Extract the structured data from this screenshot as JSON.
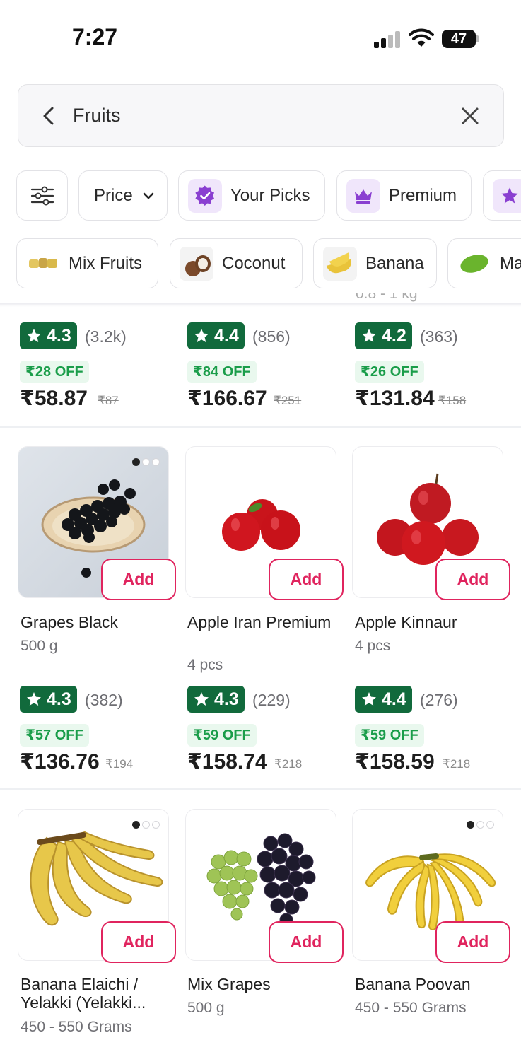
{
  "status": {
    "time": "7:27",
    "battery": "47"
  },
  "search": {
    "query": "Fruits"
  },
  "filters": {
    "price_label": "Price",
    "your_picks_label": "Your Picks",
    "premium_label": "Premium"
  },
  "categories": {
    "mix_fruits": "Mix Fruits",
    "coconut": "Coconut",
    "banana": "Banana",
    "mango": "Ma"
  },
  "row1": [
    {
      "rating": "4.3",
      "count": "(3.2k)",
      "off": "₹28 OFF",
      "price": "₹58.87",
      "mrp": "₹87"
    },
    {
      "rating": "4.4",
      "count": "(856)",
      "off": "₹84 OFF",
      "price": "₹166.67",
      "mrp": "₹251"
    },
    {
      "rating": "4.2",
      "count": "(363)",
      "off": "₹26 OFF",
      "price": "₹131.84",
      "mrp": "₹158"
    }
  ],
  "row2": [
    {
      "name": "Grapes Black",
      "qty": "500 g",
      "rating": "4.3",
      "count": "(382)",
      "off": "₹57 OFF",
      "price": "₹136.76",
      "mrp": "₹194",
      "add": "Add"
    },
    {
      "name": "Apple Iran Premium",
      "qty": "4 pcs",
      "rating": "4.3",
      "count": "(229)",
      "off": "₹59 OFF",
      "price": "₹158.74",
      "mrp": "₹218",
      "add": "Add"
    },
    {
      "name": "Apple Kinnaur",
      "qty": "4 pcs",
      "rating": "4.4",
      "count": "(276)",
      "off": "₹59 OFF",
      "price": "₹158.59",
      "mrp": "₹218",
      "add": "Add"
    }
  ],
  "row3": [
    {
      "name": "Banana Elaichi / Yelakki (Yelakki...",
      "qty": "450 - 550 Grams",
      "add": "Add"
    },
    {
      "name": "Mix Grapes",
      "qty": "500 g",
      "add": "Add"
    },
    {
      "name": "Banana Poovan",
      "qty": "450 - 550 Grams",
      "add": "Add"
    }
  ],
  "colors": {
    "accent": "#e0245e",
    "rating_bg": "#116a3c",
    "offer": "#1a9d4a",
    "picks": "#8a3fd1"
  }
}
